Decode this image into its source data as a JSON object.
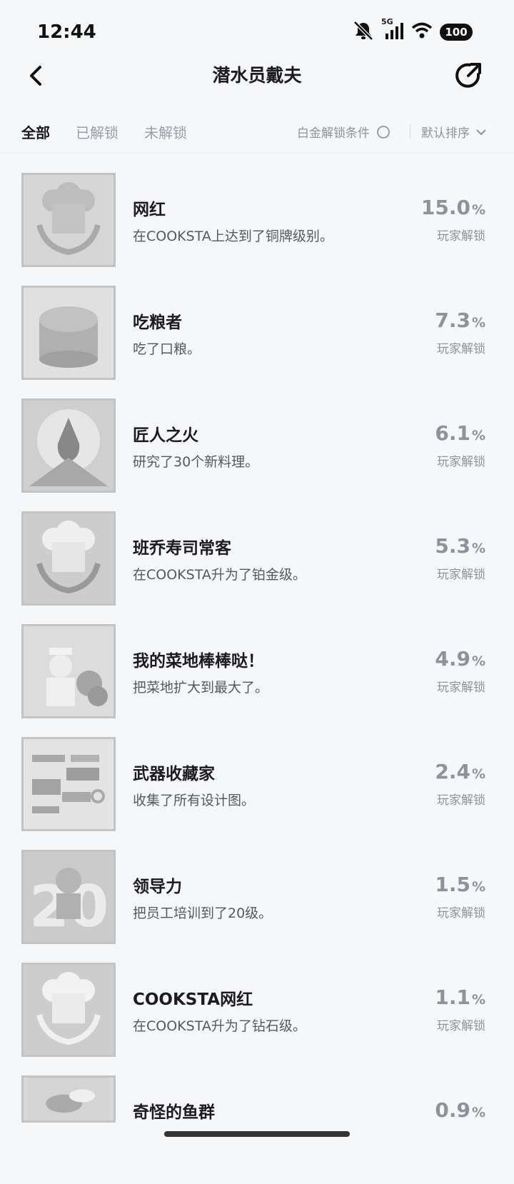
{
  "status": {
    "time": "12:44",
    "network": "5G",
    "battery": "100"
  },
  "nav": {
    "title": "潜水员戴夫"
  },
  "filters": {
    "tabs": [
      "全部",
      "已解锁",
      "未解锁"
    ],
    "active_tab": "全部",
    "condition_label": "白金解锁条件",
    "sort_label": "默认排序"
  },
  "achievements": [
    {
      "name": "网红",
      "desc": "在COOKSTA上达到了铜牌级别。",
      "percent": "15.0",
      "label": "玩家解锁",
      "icon": "chef-hat-wreath-icon"
    },
    {
      "name": "吃粮者",
      "desc": "吃了口粮。",
      "percent": "7.3",
      "label": "玩家解锁",
      "icon": "ration-can-icon"
    },
    {
      "name": "匠人之火",
      "desc": "研究了30个新料理。",
      "percent": "6.1",
      "label": "玩家解锁",
      "icon": "flame-icon"
    },
    {
      "name": "班乔寿司常客",
      "desc": "在COOKSTA升为了铂金级。",
      "percent": "5.3",
      "label": "玩家解锁",
      "icon": "chef-hat-wreath-icon"
    },
    {
      "name": "我的菜地棒棒哒！",
      "desc": "把菜地扩大到最大了。",
      "percent": "4.9",
      "label": "玩家解锁",
      "icon": "farmer-icon"
    },
    {
      "name": "武器收藏家",
      "desc": "收集了所有设计图。",
      "percent": "2.4",
      "label": "玩家解锁",
      "icon": "weapons-icon"
    },
    {
      "name": "领导力",
      "desc": "把员工培训到了20级。",
      "percent": "1.5",
      "label": "玩家解锁",
      "icon": "level-20-icon"
    },
    {
      "name": "COOKSTA网红",
      "desc": "在COOKSTA升为了钻石级。",
      "percent": "1.1",
      "label": "玩家解锁",
      "icon": "chef-hat-wreath-icon"
    },
    {
      "name": "奇怪的鱼群",
      "desc": "",
      "percent": "0.9",
      "label": "",
      "icon": "fish-school-icon"
    }
  ]
}
